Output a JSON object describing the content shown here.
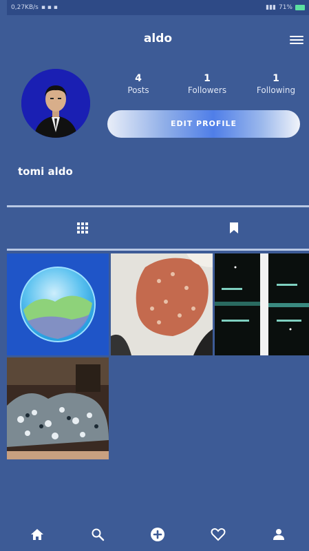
{
  "status_bar": {
    "left_text": "0,27KB/s",
    "right_text": "71%"
  },
  "header": {
    "title": "aldo"
  },
  "profile": {
    "username": "tomi aldo",
    "stats": [
      {
        "value": "4",
        "label": "Posts"
      },
      {
        "value": "1",
        "label": "Followers"
      },
      {
        "value": "1",
        "label": "Following"
      }
    ],
    "edit_button_label": "EDIT PROFILE"
  },
  "tabs": [
    {
      "icon": "grid-icon"
    },
    {
      "icon": "bookmark-icon"
    }
  ],
  "posts": [
    {
      "kind": "globe-image"
    },
    {
      "kind": "cells-microscope-image"
    },
    {
      "kind": "dark-screen-image"
    },
    {
      "kind": "crowd-art-image"
    }
  ],
  "bottom_nav": [
    {
      "icon": "home-icon"
    },
    {
      "icon": "search-icon"
    },
    {
      "icon": "add-icon"
    },
    {
      "icon": "heart-icon"
    },
    {
      "icon": "profile-icon"
    }
  ],
  "colors": {
    "background": "#3d5b96",
    "accent": "#4f7ee8",
    "divider": "#b8c8e4"
  }
}
